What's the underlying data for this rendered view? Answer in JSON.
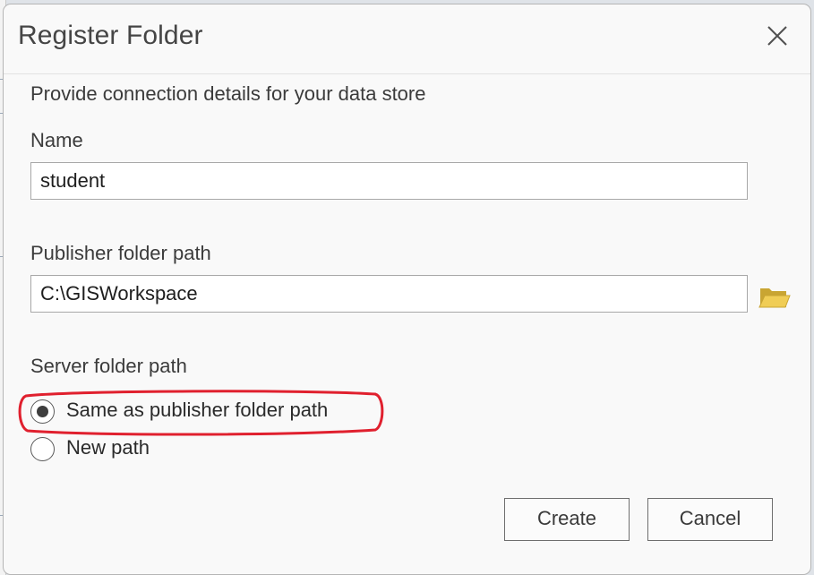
{
  "dialog": {
    "title": "Register Folder",
    "close_icon": "close-icon",
    "description": "Provide connection details for your data store"
  },
  "form": {
    "name_label": "Name",
    "name_value": "student",
    "publisher_label": "Publisher folder path",
    "publisher_value": "C:\\GISWorkspace",
    "browse_icon": "folder-open-icon",
    "server_label": "Server folder path",
    "server_options": [
      {
        "label": "Same as publisher folder path",
        "selected": true
      },
      {
        "label": "New path",
        "selected": false
      }
    ]
  },
  "buttons": {
    "create_label": "Create",
    "cancel_label": "Cancel"
  },
  "annotation": {
    "highlight_color": "#e0202e",
    "target": "Same as publisher folder path"
  },
  "colors": {
    "folder_icon": "#e8c547",
    "dialog_bg": "#f9f9f9"
  }
}
